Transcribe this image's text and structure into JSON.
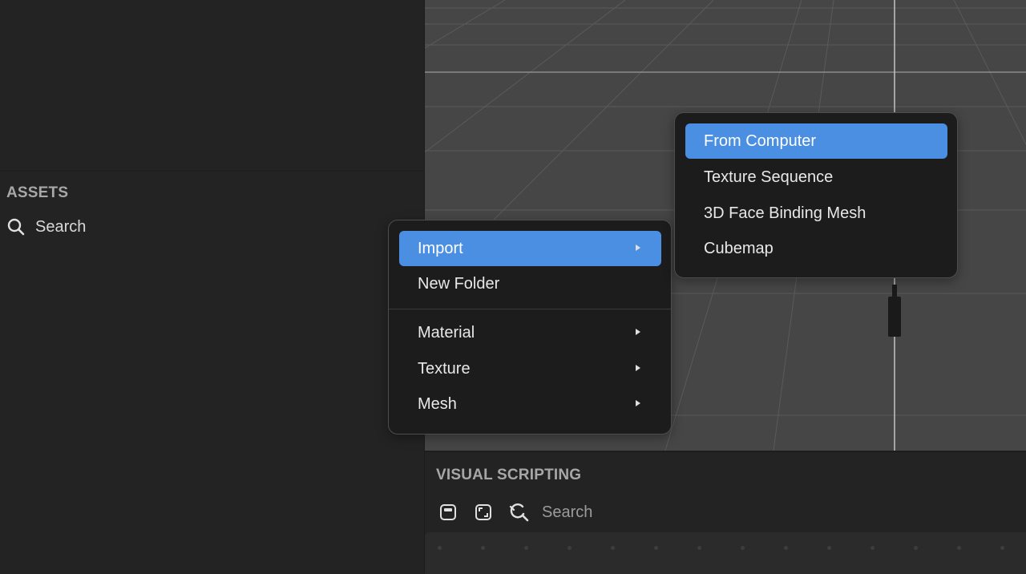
{
  "assets": {
    "title": "ASSETS",
    "search_placeholder": "Search",
    "search_icon": "magnifier-icon"
  },
  "context_menu": {
    "items": [
      {
        "label": "Import",
        "has_submenu": true,
        "highlighted": true
      },
      {
        "label": "New Folder",
        "has_submenu": false
      },
      {
        "label": "Material",
        "has_submenu": true
      },
      {
        "label": "Texture",
        "has_submenu": true
      },
      {
        "label": "Mesh",
        "has_submenu": true
      }
    ]
  },
  "import_submenu": {
    "items": [
      {
        "label": "From Computer",
        "highlighted": true
      },
      {
        "label": "Texture Sequence"
      },
      {
        "label": "3D Face Binding Mesh"
      },
      {
        "label": "Cubemap"
      }
    ]
  },
  "visual_scripting": {
    "title": "VISUAL SCRIPTING",
    "search_placeholder": "Search",
    "toolbar_icons": [
      "collapse-node-icon",
      "fit-view-icon",
      "node-search-icon"
    ]
  },
  "colors": {
    "accent": "#4b8fe3",
    "panel_bg": "#232323",
    "viewport_bg": "#464646",
    "menu_bg": "#1c1c1c"
  }
}
